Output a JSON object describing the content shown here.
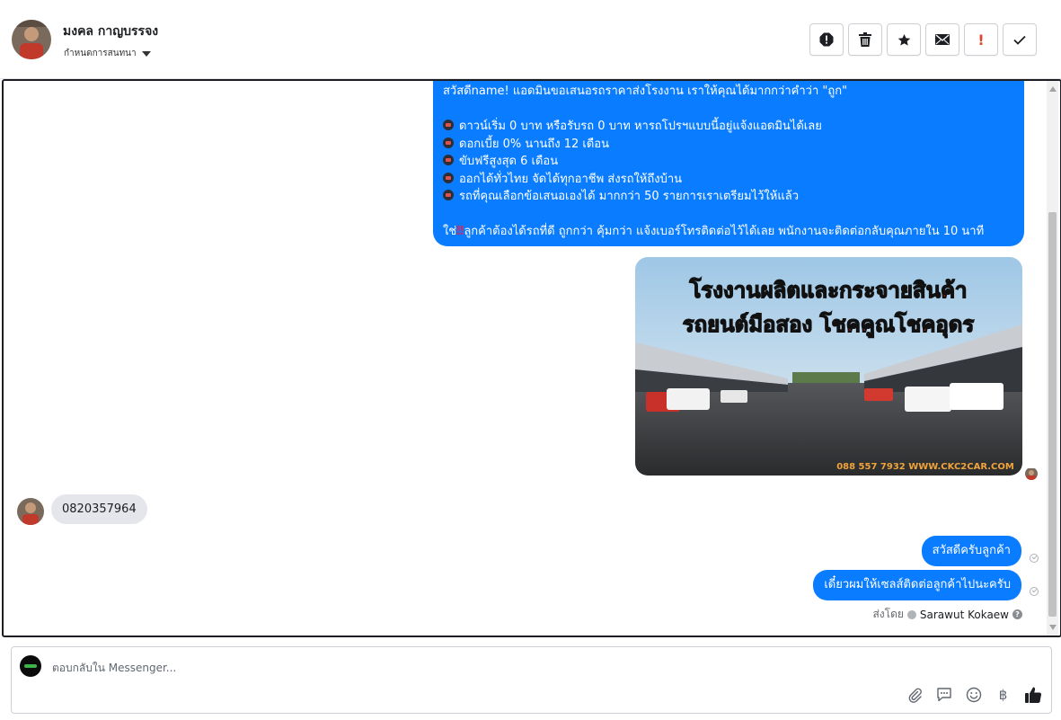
{
  "contact": {
    "name": "มงคล กาญบรรจง",
    "status_selector": "กำหนดการสนทนา"
  },
  "toolbar": {
    "spam": "spam-icon",
    "delete": "trash-icon",
    "star": "star-icon",
    "unread": "envelope-icon",
    "follow_up": "!",
    "done": "check-icon"
  },
  "messages": {
    "promo": {
      "greeting": "สวัสดีname! แอดมินขอเสนอรถราคาส่งโรงงาน เราให้คุณได้มากกว่าคำว่า \"ถูก\"",
      "bullets": [
        "ดาวน์เริ่ม 0 บาท หรือรับรถ 0 บาท หารถโปรฯแบบนี้อยู่แจ้งแอดมินได้เลย",
        "ดอกเบี้ย 0% นานถึง 12 เดือน",
        "ขับฟรีสูงสุด 6 เดือน",
        "ออกได้ทั่วไทย จัดได้ทุกอาชีพ ส่งรถให้ถึงบ้าน",
        "รถที่คุณเลือกข้อเสนอเองได้ มากกว่า 50 รายการเราเตรียมไว้ให้แล้ว"
      ],
      "closing_prefix": "ใช่",
      "closing_rest": "ลูกค้าต้องได้รถที่ดี ถูกกว่า คุ้มกว่า แจ้งเบอร์โทรติดต่อไว้ได้เลย พนักงานจะติดต่อกลับคุณภายใน 10 นาที"
    },
    "image": {
      "headline_1": "โรงงานผลิตและกระจายสินค้า",
      "headline_2": "รถยนต์มือสอง โชคคูณโชคอุดร",
      "footer": "088 557 7932 WWW.CKC2CAR.COM"
    },
    "incoming_phone": "0820357964",
    "reply_1": "สวัสดีครับลูกค้า",
    "reply_2": "เดี๋ยวผมให้เซลส์ติดต่อลูกค้าไปนะครับ",
    "sent_by_label": "ส่งโดย",
    "sent_by_name": "Sarawut Kokaew"
  },
  "composer": {
    "placeholder": "ตอบกลับใน Messenger...",
    "tools": [
      "paperclip-icon",
      "saved-reply-icon",
      "emoji-icon",
      "baht-icon",
      "thumbs-up-icon"
    ],
    "baht": "฿"
  },
  "colors": {
    "outgoing_bubble": "#0a7cff",
    "incoming_bubble": "#e4e6eb",
    "headline_red": "#d62a1e"
  }
}
